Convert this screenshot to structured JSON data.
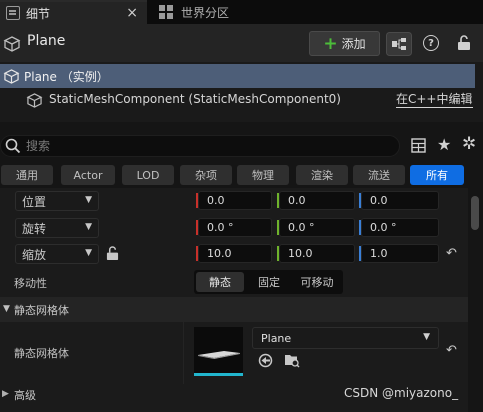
{
  "tabs": [
    {
      "label": "细节",
      "close": "×"
    },
    {
      "label": "世界分区"
    }
  ],
  "header": {
    "object_name": "Plane",
    "add_label": "添加",
    "add_plus": "+",
    "help_glyph": "?"
  },
  "tree": {
    "root_label": "Plane （实例）",
    "component_label": "StaticMeshComponent (StaticMeshComponent0)",
    "edit_cpp": "在C++中编辑"
  },
  "search": {
    "placeholder": "搜索"
  },
  "filters": [
    {
      "label": "通用"
    },
    {
      "label": "Actor"
    },
    {
      "label": "LOD"
    },
    {
      "label": "杂项"
    },
    {
      "label": "物理"
    },
    {
      "label": "渲染"
    },
    {
      "label": "流送"
    },
    {
      "label": "所有",
      "active": true
    }
  ],
  "transform": {
    "location": {
      "label": "位置",
      "x": "0.0",
      "y": "0.0",
      "z": "0.0"
    },
    "rotation": {
      "label": "旋转",
      "x": "0.0 °",
      "y": "0.0 °",
      "z": "0.0 °"
    },
    "scale": {
      "label": "缩放",
      "x": "10.0",
      "y": "10.0",
      "z": "1.0"
    }
  },
  "axis_colors": {
    "x": "#c8302a",
    "y": "#6fb32c",
    "z": "#3a7fd6"
  },
  "mobility": {
    "label": "移动性",
    "options": [
      "静态",
      "固定",
      "可移动"
    ],
    "selected": "静态"
  },
  "section": {
    "title": "静态网格体",
    "mesh_label": "静态网格体",
    "mesh_value": "Plane",
    "thumbnail_accent": "#22b6ce"
  },
  "advanced": {
    "label": "高级"
  },
  "watermark": "CSDN @miyazono_",
  "icons": {
    "reset": "↶",
    "chevron": "▼",
    "arrow_down": "▼",
    "arrow_right": "▶",
    "star": "★",
    "gear": "✲"
  }
}
